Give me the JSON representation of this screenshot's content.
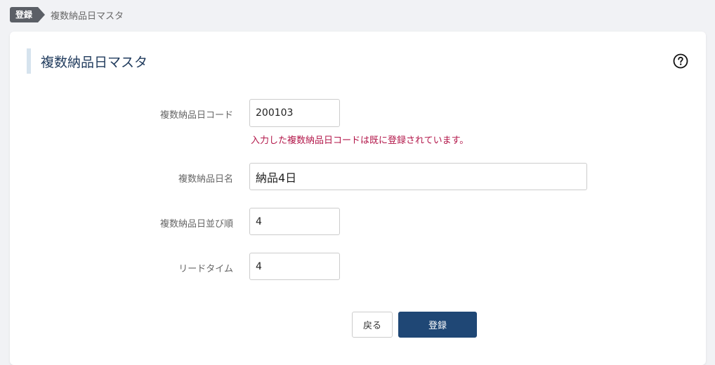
{
  "breadcrumb": {
    "badge": "登録",
    "current": "複数納品日マスタ"
  },
  "page": {
    "title": "複数納品日マスタ"
  },
  "form": {
    "code": {
      "label": "複数納品日コード",
      "value": "200103",
      "error": "入力した複数納品日コードは既に登録されています。"
    },
    "name": {
      "label": "複数納品日名",
      "value": "納品4日"
    },
    "order": {
      "label": "複数納品日並び順",
      "value": "4"
    },
    "lead_time": {
      "label": "リードタイム",
      "value": "4"
    }
  },
  "buttons": {
    "back": "戻る",
    "register": "登録"
  },
  "colors": {
    "primary": "#1f4775",
    "error": "#b3174a",
    "title": "#1f3a5c"
  }
}
